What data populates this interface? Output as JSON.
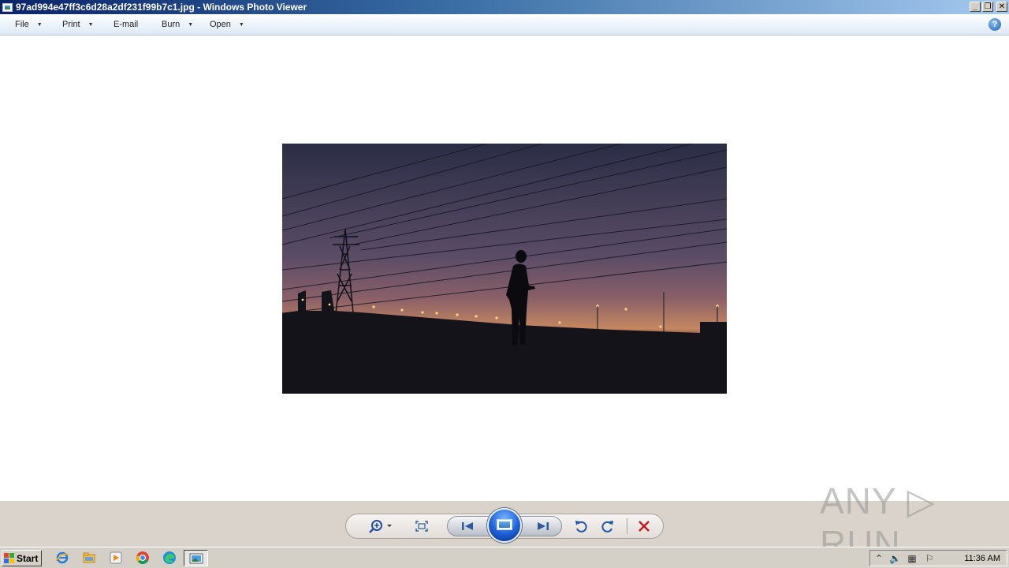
{
  "window": {
    "title": "97ad994e47ff3c6d28a2df231f99b7c1.jpg - Windows Photo Viewer",
    "minimize_glyph": "_",
    "restore_glyph": "❐",
    "close_glyph": "✕"
  },
  "menu": {
    "items": [
      {
        "label": "File",
        "has_dropdown": true
      },
      {
        "label": "Print",
        "has_dropdown": true
      },
      {
        "label": "E-mail",
        "has_dropdown": false
      },
      {
        "label": "Burn",
        "has_dropdown": true
      },
      {
        "label": "Open",
        "has_dropdown": true
      }
    ],
    "help_glyph": "?"
  },
  "photo": {
    "subject": "silhouette-at-dusk",
    "colors": {
      "sky_top": "#2b2d45",
      "sky_mid": "#6a5468",
      "sky_horizon": "#c58760",
      "ground": "#0d0c10"
    }
  },
  "controls": {
    "icons": [
      "zoom-icon",
      "actual-size-icon",
      "previous-icon",
      "slideshow-icon",
      "next-icon",
      "rotate-ccw-icon",
      "rotate-cw-icon",
      "delete-icon"
    ]
  },
  "watermark": {
    "text": "ANY ▷ RUN"
  },
  "taskbar": {
    "start_label": "Start",
    "clock": "11:36 AM"
  }
}
